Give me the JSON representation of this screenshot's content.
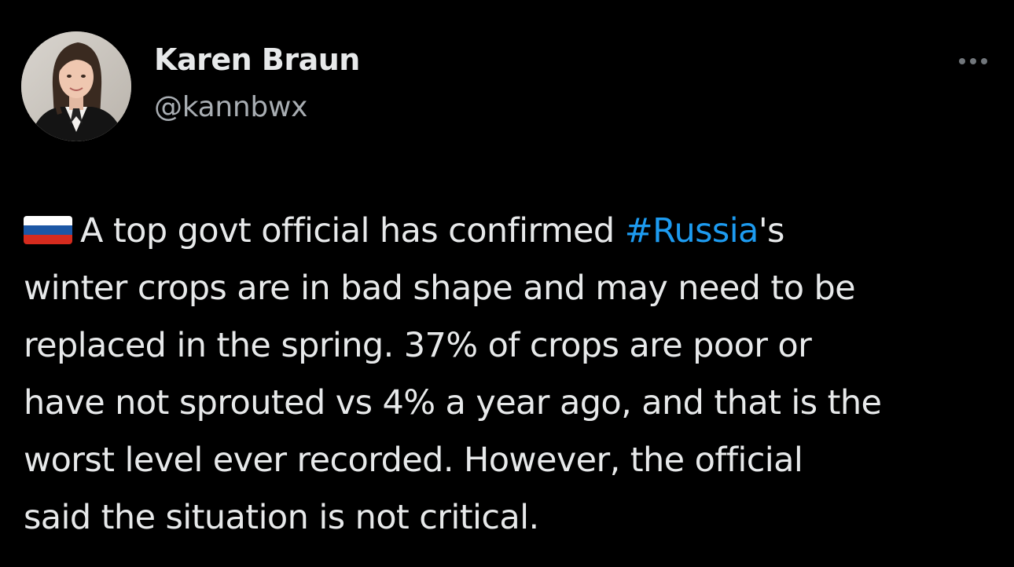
{
  "user": {
    "display_name": "Karen Braun",
    "handle": "@kannbwx"
  },
  "menu": {
    "more_icon": "more-horizontal-icon"
  },
  "tweet": {
    "flag_icon": "russia-flag-icon",
    "flag_colors": [
      "#ffffff",
      "#1c57a5",
      "#d52b1e"
    ],
    "line1_before": "A top govt official has confirmed ",
    "hashtag": "#Russia",
    "line1_after": "'s",
    "line2": "winter crops are in bad shape and may need to be",
    "line3": "replaced in the spring. 37% of crops are poor or",
    "line4": "have not sprouted vs 4% a year ago, and that is the",
    "line5": "worst level ever recorded. However, the official",
    "line6": "said the situation is not critical."
  },
  "colors": {
    "background": "#000000",
    "text": "#e7e9ea",
    "secondary": "#71767b",
    "link": "#1d9bf0"
  }
}
